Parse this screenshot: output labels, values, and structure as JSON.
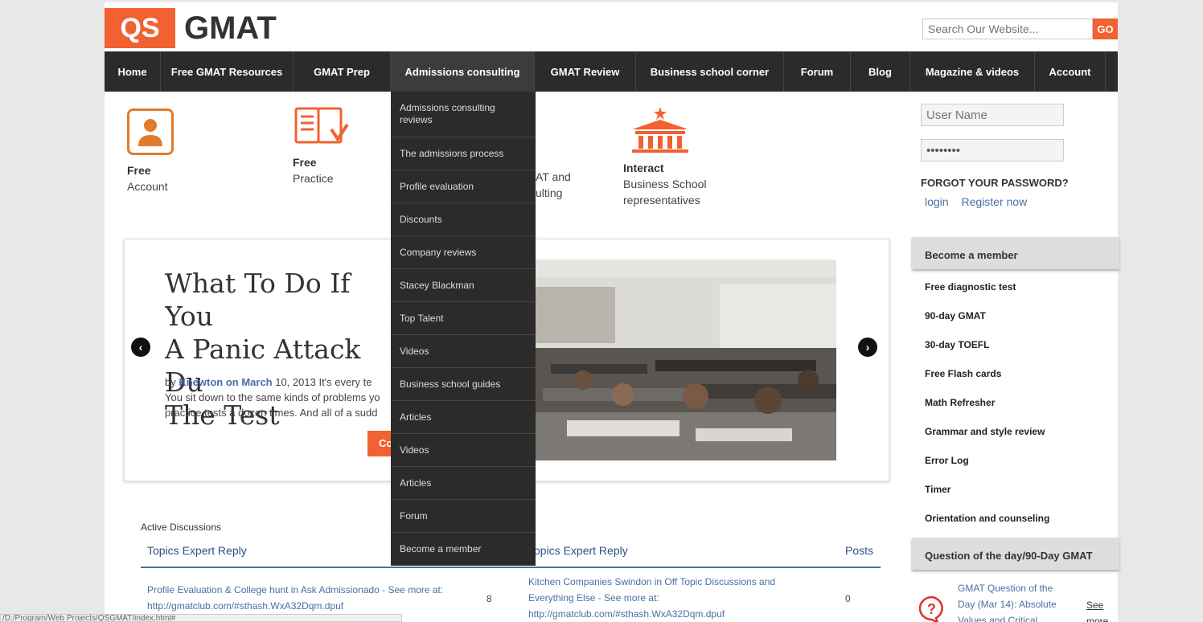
{
  "header": {
    "logo_mark": "QS",
    "logo_text": "GMAT",
    "search_placeholder": "Search Our Website...",
    "search_button": "GO"
  },
  "nav": [
    "Home",
    "Free GMAT Resources",
    "GMAT Prep",
    "Admissions consulting",
    "GMAT Review",
    "Business school corner",
    "Forum",
    "Blog",
    "Magazine & videos",
    "Account"
  ],
  "dropdown": [
    "Admissions consulting reviews",
    "The admissions process",
    "Profile evaluation",
    "Discounts",
    "Company reviews",
    "Stacey Blackman",
    "Top Talent",
    "Videos",
    "Business school guides",
    "Articles",
    "Videos",
    "Articles",
    "Forum",
    "Become a member"
  ],
  "features": {
    "f1_title": "Free",
    "f1_sub": "Account",
    "f2_title": "Free",
    "f2_sub": "Practice",
    "f3_line1": "AT and",
    "f3_line2": "ulting",
    "f4_title": "Interact",
    "f4_sub": "Business School\nrepresentatives"
  },
  "login": {
    "username_placeholder": "User Name",
    "password_value": "••••••••",
    "forgot": "FORGOT YOUR PASSWORD?",
    "login_link": "login",
    "register_link": "Register now"
  },
  "sidebar": {
    "member_title": "Become a member",
    "member_items": [
      "Free diagnostic test",
      "90-day GMAT",
      "30-day TOEFL",
      "Free Flash cards",
      "Math Refresher",
      "Grammar and style review",
      "Error Log",
      "Timer",
      "Orientation and counseling"
    ],
    "qotd_title": "Question of the day/90-Day GMAT",
    "qotd_text": "GMAT Question of the\nDay (Mar 14): Absolute\nValues and Critical",
    "qotd_see": "See",
    "qotd_more": "more"
  },
  "slide": {
    "title": "What To Do If You\nA Panic Attack Du\nThe Test",
    "by": "by ",
    "author": "Knewton on March",
    "date_text": " 10, 2013 It's every te",
    "body": "You sit down to the same kinds of problems yo\npractice tests a dozen times. And all of a sudd",
    "button": "Co"
  },
  "discussions": {
    "title": "Active Discussions",
    "col1": "Topics Expert Reply",
    "col2": "Topics Expert Reply",
    "col3": "Posts",
    "row1_text": "Profile Evaluation & College hunt in Ask Admissionado - See more at:\nhttp://gmatclub.com/#sthash.WxA32Dqm.dpuf",
    "row1_count": "8",
    "row2_text": "Kitchen Companies Swindon in Off Topic Discussions and\nEverything Else - See more at:\nhttp://gmatclub.com/#sthash.WxA32Dqm.dpuf",
    "row2_count": "0"
  },
  "status_bar": "/D:/Program/Web Projects/QSGMAT/index.html#"
}
